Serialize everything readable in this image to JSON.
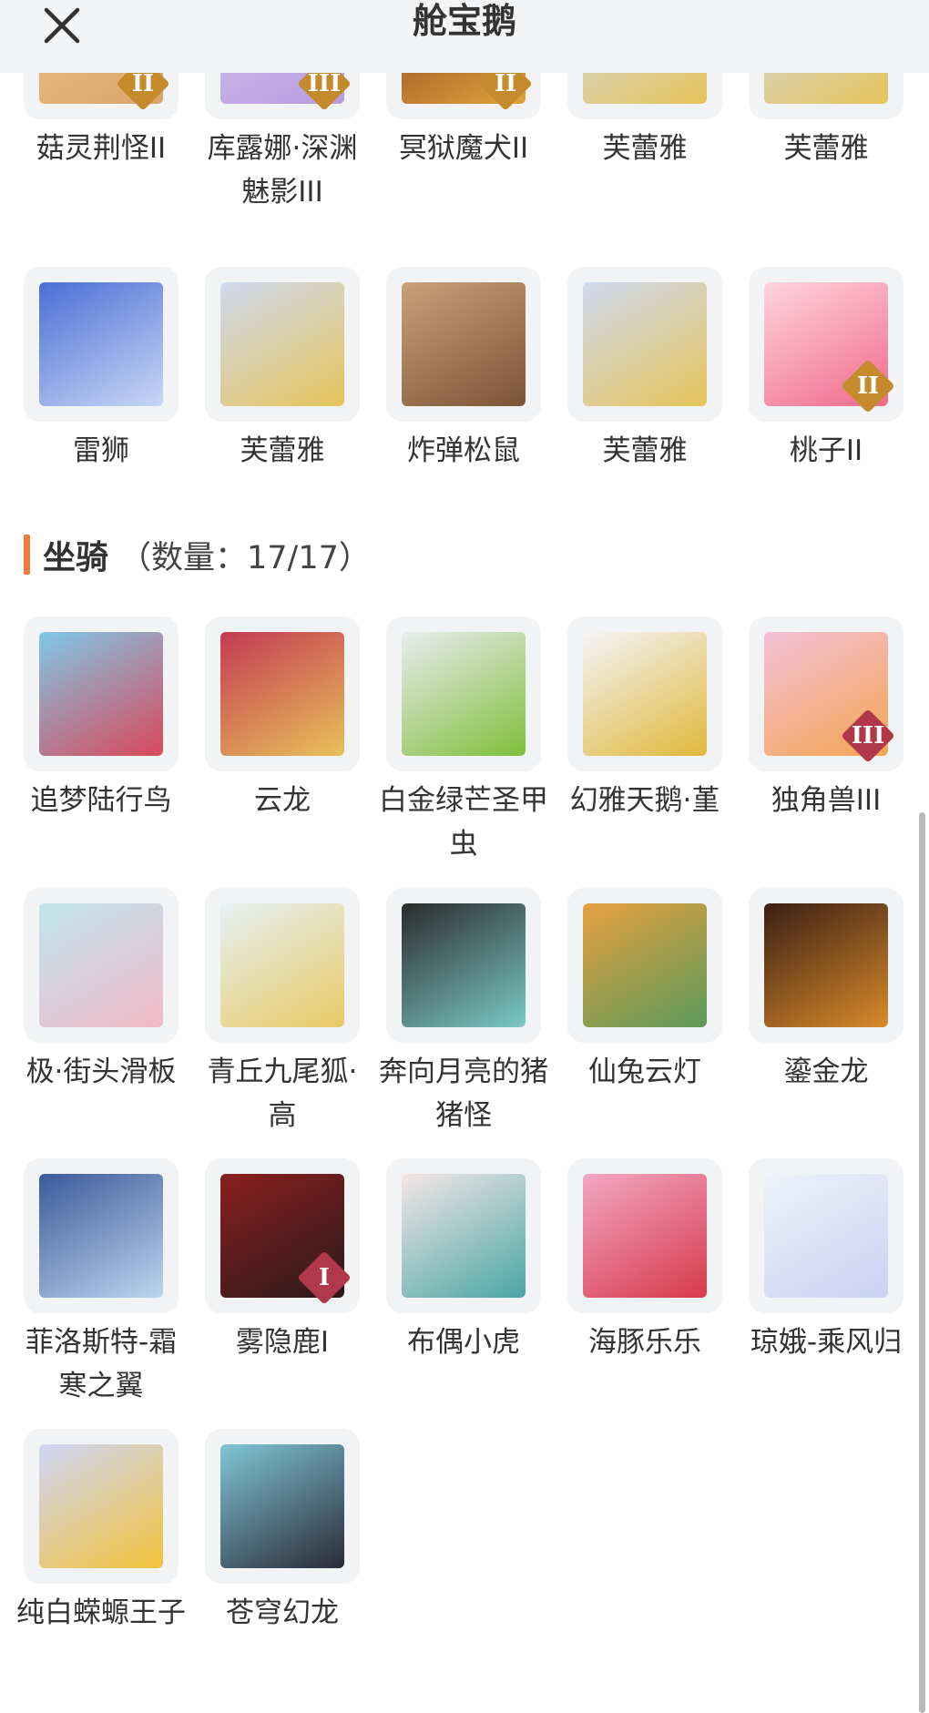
{
  "header": {
    "title": "舱宝鹅",
    "close_icon": "close-icon"
  },
  "colors": {
    "navbar_bg": "#f3f4f6",
    "accent": "#f07a3a",
    "card_bg": "#f2f3f5",
    "badge_gold": "#c48a2c",
    "badge_red": "#b0384a"
  },
  "pets": {
    "row1": [
      {
        "name": "菇灵荆怪II",
        "badge": "II",
        "badge_color": "#c48a2c",
        "art": [
          "#f4c58a",
          "#d9a46a"
        ]
      },
      {
        "name": "库露娜·深渊魅影III",
        "badge": "III",
        "badge_color": "#c48a2c",
        "art": [
          "#d8c6f2",
          "#b79be0"
        ]
      },
      {
        "name": "冥狱魔犬II",
        "badge": "II",
        "badge_color": "#c48a2c",
        "art": [
          "#8a3b22",
          "#e0a33a"
        ]
      },
      {
        "name": "芙蕾雅",
        "badge": "",
        "badge_color": "",
        "art": [
          "#cfd9ef",
          "#e6c45a"
        ]
      },
      {
        "name": "芙蕾雅",
        "badge": "",
        "badge_color": "",
        "art": [
          "#cfd9ef",
          "#e6c45a"
        ]
      }
    ],
    "row2": [
      {
        "name": "雷狮",
        "badge": "",
        "badge_color": "",
        "art": [
          "#4a6fd6",
          "#c9d7f5"
        ]
      },
      {
        "name": "芙蕾雅",
        "badge": "",
        "badge_color": "",
        "art": [
          "#cfd9ef",
          "#e6c45a"
        ]
      },
      {
        "name": "炸弹松鼠",
        "badge": "",
        "badge_color": "",
        "art": [
          "#caa07a",
          "#7a5535"
        ]
      },
      {
        "name": "芙蕾雅",
        "badge": "",
        "badge_color": "",
        "art": [
          "#cfd9ef",
          "#e6c45a"
        ]
      },
      {
        "name": "桃子II",
        "badge": "II",
        "badge_color": "#c48a2c",
        "art": [
          "#ffd4df",
          "#f06a8c"
        ]
      }
    ]
  },
  "mounts": {
    "section_title": "坐骑",
    "count_text": "（数量：17/17）",
    "items": [
      {
        "name": "追梦陆行鸟",
        "badge": "",
        "badge_color": "",
        "art": [
          "#7fc8e8",
          "#d9485a"
        ]
      },
      {
        "name": "云龙",
        "badge": "",
        "badge_color": "",
        "art": [
          "#c43a52",
          "#e8c15a"
        ]
      },
      {
        "name": "白金绿芒圣甲虫",
        "badge": "",
        "badge_color": "",
        "art": [
          "#e9ecef",
          "#7fbf3a"
        ]
      },
      {
        "name": "幻雅天鹅·堇",
        "badge": "",
        "badge_color": "",
        "art": [
          "#f4f4f8",
          "#e0b83a"
        ]
      },
      {
        "name": "独角兽III",
        "badge": "III",
        "badge_color": "#b0384a",
        "art": [
          "#f3c0d8",
          "#f4a552"
        ]
      },
      {
        "name": "极·街头滑板",
        "badge": "",
        "badge_color": "",
        "art": [
          "#bfe6ef",
          "#f2b8c6"
        ]
      },
      {
        "name": "青丘九尾狐·高",
        "badge": "",
        "badge_color": "",
        "art": [
          "#e6f1f4",
          "#e8c964"
        ]
      },
      {
        "name": "奔向月亮的猪猪怪",
        "badge": "",
        "badge_color": "",
        "art": [
          "#2b2b2b",
          "#7ac9c8"
        ]
      },
      {
        "name": "仙兔云灯",
        "badge": "",
        "badge_color": "",
        "art": [
          "#e8a040",
          "#5a9a5a"
        ]
      },
      {
        "name": "鎏金龙",
        "badge": "",
        "badge_color": "",
        "art": [
          "#3a1f14",
          "#d88a2a"
        ]
      },
      {
        "name": "菲洛斯特-霜寒之翼",
        "badge": "",
        "badge_color": "",
        "art": [
          "#3b5a9a",
          "#bcd6ef"
        ]
      },
      {
        "name": "雾隐鹿I",
        "badge": "I",
        "badge_color": "#b0384a",
        "art": [
          "#8a1f1f",
          "#2a1a1a"
        ]
      },
      {
        "name": "布偶小虎",
        "badge": "",
        "badge_color": "",
        "art": [
          "#f4e6e6",
          "#4aa6a6"
        ]
      },
      {
        "name": "海豚乐乐",
        "badge": "",
        "badge_color": "",
        "art": [
          "#f2a6c4",
          "#d83a4a"
        ]
      },
      {
        "name": "琼娥-乘风归",
        "badge": "",
        "badge_color": "",
        "art": [
          "#eef2fb",
          "#c9d2f2"
        ]
      },
      {
        "name": "纯白蝾螈王子",
        "badge": "",
        "badge_color": "",
        "art": [
          "#cfd6f6",
          "#f2c23a"
        ]
      },
      {
        "name": "苍穹幻龙",
        "badge": "",
        "badge_color": "",
        "art": [
          "#7fc6d6",
          "#2a2a38"
        ]
      }
    ]
  }
}
